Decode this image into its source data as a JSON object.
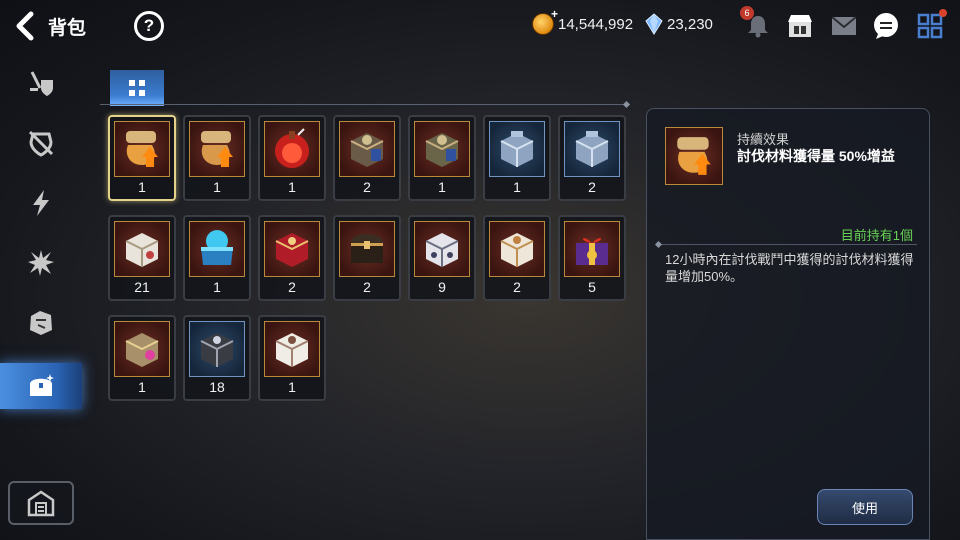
{
  "header": {
    "title": "背包",
    "help_label": "?"
  },
  "currency": {
    "gold": "14,544,992",
    "gems": "23,230"
  },
  "notifications": {
    "bell_count": "6"
  },
  "sidebar": {
    "items": [
      {
        "icon": "sword-shield-icon"
      },
      {
        "icon": "broken-armor-icon"
      },
      {
        "icon": "lightning-icon"
      },
      {
        "icon": "splash-icon"
      },
      {
        "icon": "rune-stone-icon"
      },
      {
        "icon": "treasure-chest-icon",
        "active": true
      }
    ],
    "bottom_icon": "warehouse-icon"
  },
  "inventory": {
    "filter_icon": "grid-icon",
    "items": [
      {
        "icon": "scroll-bag-icon",
        "qty": "1",
        "selected": true
      },
      {
        "icon": "scroll-bag-icon",
        "qty": "1"
      },
      {
        "icon": "red-potion-icon",
        "qty": "1"
      },
      {
        "icon": "armored-box-icon",
        "qty": "2"
      },
      {
        "icon": "armored-box-icon",
        "qty": "1"
      },
      {
        "icon": "steel-chest-icon",
        "qty": "1"
      },
      {
        "icon": "steel-chest-icon",
        "qty": "2"
      },
      {
        "icon": "white-box-icon",
        "qty": "21"
      },
      {
        "icon": "blue-chest-icon",
        "qty": "1"
      },
      {
        "icon": "red-chest-icon",
        "qty": "2"
      },
      {
        "icon": "dark-chest-icon",
        "qty": "2"
      },
      {
        "icon": "white-box-icon",
        "qty": "9"
      },
      {
        "icon": "white-box-icon",
        "qty": "2"
      },
      {
        "icon": "gift-box-icon",
        "qty": "5"
      },
      {
        "icon": "purple-box-icon",
        "qty": "1"
      },
      {
        "icon": "black-box-icon",
        "qty": "18"
      },
      {
        "icon": "white-box-icon",
        "qty": "1"
      }
    ]
  },
  "detail": {
    "category": "持續效果",
    "name": "討伐材料獲得量 50%增益",
    "owned": "目前持有1個",
    "description": "12小時內在討伐戰鬥中獲得的討伐材料獲得量增加50%。",
    "use_label": "使用"
  },
  "colors": {
    "accent_blue": "#3c7cd0",
    "owned_green": "#66d054",
    "slot_selected": "#e4d28a"
  }
}
